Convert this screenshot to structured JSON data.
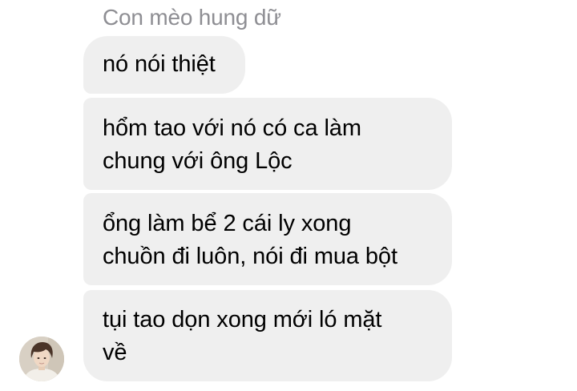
{
  "sender": {
    "name": "Con mèo hung dữ"
  },
  "messages": [
    {
      "lines": [
        "nó nói thiệt"
      ]
    },
    {
      "lines": [
        "hổm tao với nó có ca làm",
        "chung với ông Lộc"
      ]
    },
    {
      "lines": [
        "ổng làm bể 2 cái ly xong",
        "chuồn đi luôn, nói đi mua bột"
      ]
    },
    {
      "lines": [
        "tụi tao dọn xong mới ló mặt",
        "về"
      ]
    }
  ],
  "avatar": {
    "icon": "user-avatar-photo"
  },
  "colors": {
    "bubble_background": "#efefef",
    "sender_name": "#8e8e93",
    "page_background": "#ffffff"
  }
}
